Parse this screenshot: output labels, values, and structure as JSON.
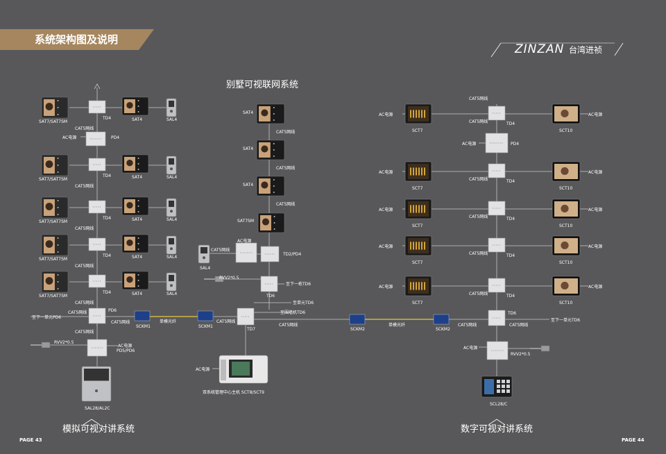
{
  "header": {
    "banner_title": "系统架构图及说明",
    "brand": "ZINZAN",
    "brand_cn": "台湾进祯"
  },
  "titles": {
    "villa": "别墅可视联网系统",
    "analog": "模拟可视对讲系统",
    "digital": "数字可视对讲系统"
  },
  "pages": {
    "left": "PAGE 43",
    "right": "PAGE 44"
  },
  "colors": {
    "background": "#58585a",
    "banner": "#a5865f",
    "line": "#c8c8c8",
    "fiber": "#e8c840"
  },
  "labels": {
    "sat7": "SAT7/SAT7SM",
    "sat7b": "SAT7/SAT7SM",
    "sat4": "SAT4",
    "sal4": "SAL4",
    "td4": "TD4",
    "pd4": "PD4",
    "pd6": "PD6",
    "pd5pd6": "PD5/PD6",
    "cat5": "CAT5网线",
    "ac": "AC电源",
    "rvv": "RVV2*0.5",
    "sckm1": "SCKM1",
    "sckm2": "SCKM2",
    "fiber": "单模光纤",
    "to_next_pd6": "至下一单元PD6",
    "to_next_td6": "至下一单元TD6",
    "sal28": "SAL28/AL2C",
    "sat7sm": "SAT7SM",
    "td2pd4": "TD2/PD4",
    "td6": "TD6",
    "td7": "TD7",
    "to_next_building_td6": "至下一栋TD6",
    "to_unit_td6": "至单元TD6",
    "to_wall_td6": "至围墙机TD6",
    "center": "双系统管理中心主机 SCT8/SCT9",
    "sct7": "SCT7",
    "sct10": "SCT10",
    "scl28": "SCL28/C"
  }
}
